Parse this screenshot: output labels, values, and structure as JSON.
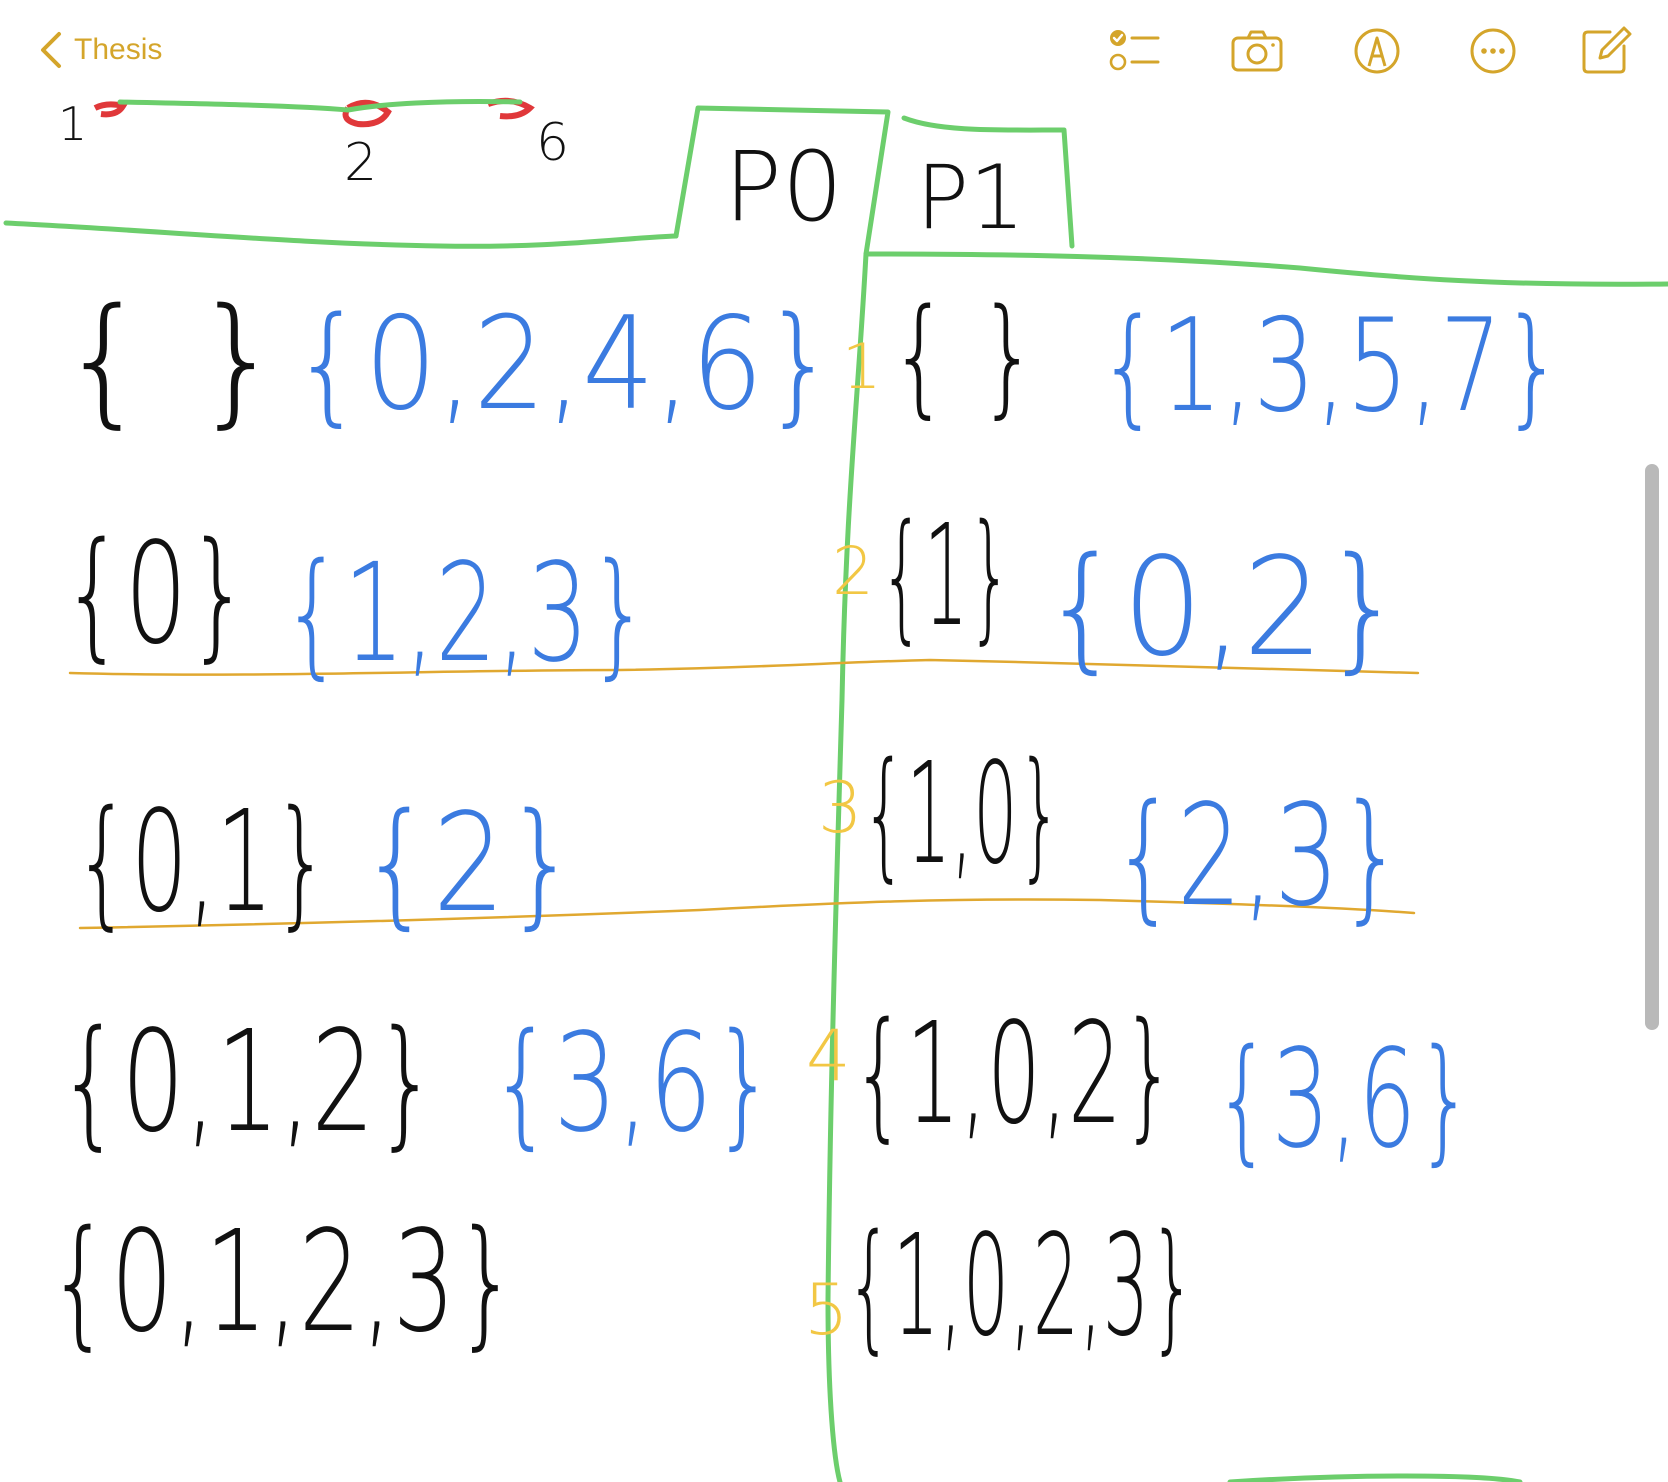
{
  "toolbar": {
    "back_label": "Thesis",
    "accent_color": "#d4a52b",
    "icons": [
      "checklist-icon",
      "camera-icon",
      "markup-icon",
      "more-icon",
      "compose-icon"
    ]
  },
  "note": {
    "top_labels": {
      "a": "1",
      "b": "2",
      "c": "6"
    },
    "headers": {
      "p0": "P0",
      "p1": "P1"
    },
    "step_numbers": [
      "1",
      "2",
      "3",
      "4",
      "5"
    ],
    "p0_rows": [
      {
        "set": "{ }",
        "rest": "{0,2,4,6}"
      },
      {
        "set": "{0}",
        "rest": "{1,2,3}"
      },
      {
        "set": "{0,1}",
        "rest": "{2}"
      },
      {
        "set": "{0,1,2}",
        "rest": "{3,6}"
      },
      {
        "set": "{0,1,2,3}",
        "rest": ""
      }
    ],
    "p1_rows": [
      {
        "set": "{ }",
        "rest": "{1,3,5,7}"
      },
      {
        "set": "{1}",
        "rest": "{0,2}"
      },
      {
        "set": "{1,0}",
        "rest": "{2,3}"
      },
      {
        "set": "{1,0,2}",
        "rest": "{3,6}"
      },
      {
        "set": "{1,0,2,3}",
        "rest": ""
      }
    ],
    "colors": {
      "black_ink": "#111111",
      "blue_ink": "#3b7be0",
      "green_ink": "#6cce6c",
      "yellow_ink": "#f2c744",
      "orange_line": "#e0a830",
      "red_ink": "#e0383a"
    }
  }
}
